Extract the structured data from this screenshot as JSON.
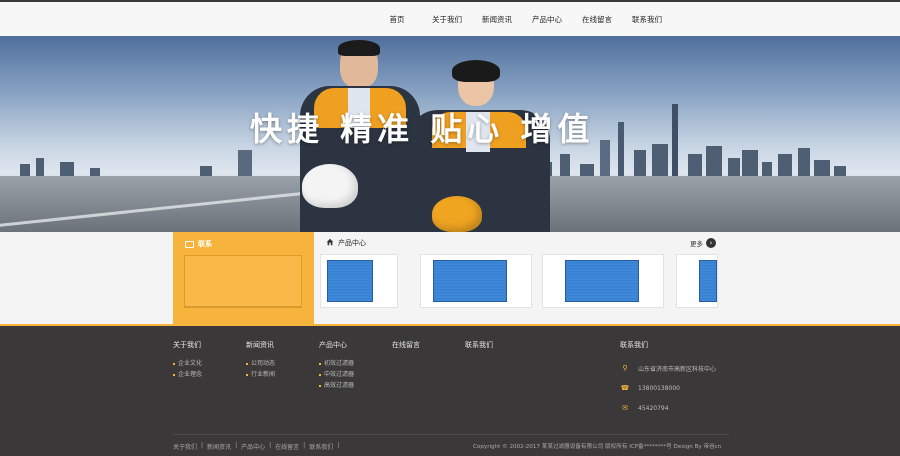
{
  "nav": {
    "items": [
      "首页",
      "关于我们",
      "新闻资讯",
      "产品中心",
      "在线留言",
      "联系我们"
    ]
  },
  "banner": {
    "slogan": "快捷 精准 贴心 增值"
  },
  "contact_box": {
    "title": "联系"
  },
  "products": {
    "title": "产品中心",
    "more_label": "更多",
    "more_icon": "arrow-right-icon"
  },
  "footer": {
    "columns": [
      {
        "heading": "关于我们",
        "items": [
          "企业文化",
          "企业理念"
        ]
      },
      {
        "heading": "新闻资讯",
        "items": [
          "公司动态",
          "行业新闻"
        ]
      },
      {
        "heading": "产品中心",
        "items": [
          "初效过滤器",
          "中效过滤器",
          "高效过滤器"
        ]
      },
      {
        "heading": "在线留言",
        "items": []
      },
      {
        "heading": "联系我们",
        "items": []
      }
    ],
    "contact": {
      "heading": "联系我们",
      "address": "山东省济南市高新区科技中心",
      "phone": "13800138000",
      "qq": "45420794"
    },
    "bottom_links": [
      "关于我们",
      "新闻资讯",
      "产品中心",
      "在线留言",
      "联系我们"
    ],
    "copyright": "Copyright © 2002-2017 某某过滤器设备有限公司 版权所有 ICP备********号 Design By 帝谷cn"
  },
  "colors": {
    "accent": "#f7b43c",
    "footer_bg": "#3a3839"
  }
}
